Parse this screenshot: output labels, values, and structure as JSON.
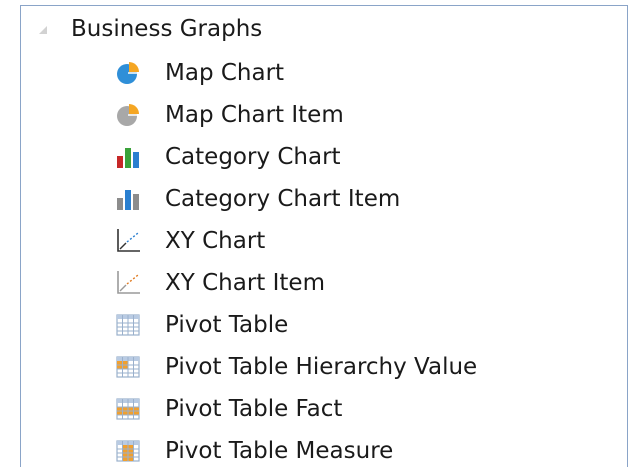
{
  "tree": {
    "group": {
      "label": "Business Graphs",
      "toggle_icon": "triangle-expanded-icon"
    },
    "items": [
      {
        "label": "Map Chart",
        "icon": "map-chart-icon"
      },
      {
        "label": "Map Chart Item",
        "icon": "map-chart-item-icon"
      },
      {
        "label": "Category Chart",
        "icon": "category-chart-icon"
      },
      {
        "label": "Category Chart Item",
        "icon": "category-chart-item-icon"
      },
      {
        "label": "XY Chart",
        "icon": "xy-chart-icon"
      },
      {
        "label": "XY Chart Item",
        "icon": "xy-chart-item-icon"
      },
      {
        "label": "Pivot Table",
        "icon": "pivot-table-icon"
      },
      {
        "label": "Pivot Table Hierarchy Value",
        "icon": "pivot-table-hierarchy-value-icon"
      },
      {
        "label": "Pivot Table Fact",
        "icon": "pivot-table-fact-icon"
      },
      {
        "label": "Pivot Table Measure",
        "icon": "pivot-table-measure-icon"
      }
    ]
  },
  "colors": {
    "panel_border": "#8aa4c8",
    "text": "#1a1a1a",
    "map_blue": "#2f8fd8",
    "map_orange": "#f5a623",
    "map_gray": "#a8a8a8",
    "bar_red": "#c62828",
    "bar_green": "#3aa23a",
    "bar_blue": "#2a7fd0",
    "bar_gray": "#8c8c8c",
    "pivot_orange": "#f0a030",
    "pivot_grid": "#9ab0cc"
  }
}
